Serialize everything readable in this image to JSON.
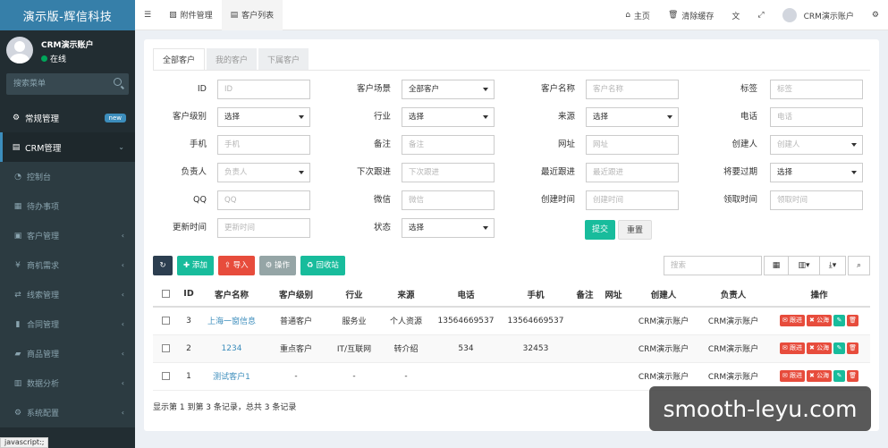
{
  "app": {
    "title": "演示版-辉信科技"
  },
  "user": {
    "name": "CRM演示账户",
    "status": "在线"
  },
  "sidebar": {
    "search_placeholder": "搜索菜单",
    "items": [
      {
        "label": "常规管理",
        "badge": "new"
      },
      {
        "label": "CRM管理"
      },
      {
        "label": "控制台"
      },
      {
        "label": "待办事项"
      },
      {
        "label": "客户管理"
      },
      {
        "label": "商机需求"
      },
      {
        "label": "线索管理"
      },
      {
        "label": "合同管理"
      },
      {
        "label": "商品管理"
      },
      {
        "label": "数据分析"
      },
      {
        "label": "系统配置"
      }
    ]
  },
  "topbar": {
    "nav": [
      "附件管理",
      "客户列表"
    ],
    "home": "主页",
    "clear_cache": "清除缓存",
    "account": "CRM演示账户"
  },
  "tabs": [
    "全部客户",
    "我的客户",
    "下属客户"
  ],
  "filters": {
    "rows": [
      [
        {
          "label": "ID",
          "type": "input",
          "placeholder": "ID"
        },
        {
          "label": "客户场景",
          "type": "select",
          "value": "全部客户"
        },
        {
          "label": "客户名称",
          "type": "input",
          "placeholder": "客户名称"
        },
        {
          "label": "标签",
          "type": "input",
          "placeholder": "标签"
        }
      ],
      [
        {
          "label": "客户级别",
          "type": "select",
          "value": "选择"
        },
        {
          "label": "行业",
          "type": "select",
          "value": "选择"
        },
        {
          "label": "来源",
          "type": "select",
          "value": "选择"
        },
        {
          "label": "电话",
          "type": "input",
          "placeholder": "电话"
        }
      ],
      [
        {
          "label": "手机",
          "type": "input",
          "placeholder": "手机"
        },
        {
          "label": "备注",
          "type": "input",
          "placeholder": "备注"
        },
        {
          "label": "网址",
          "type": "input",
          "placeholder": "网址"
        },
        {
          "label": "创建人",
          "type": "select",
          "value": "创建人",
          "ph": true
        }
      ],
      [
        {
          "label": "负责人",
          "type": "select",
          "value": "负责人",
          "ph": true
        },
        {
          "label": "下次跟进",
          "type": "input",
          "placeholder": "下次跟进"
        },
        {
          "label": "最近跟进",
          "type": "input",
          "placeholder": "最近跟进"
        },
        {
          "label": "将要过期",
          "type": "select",
          "value": "选择"
        }
      ],
      [
        {
          "label": "QQ",
          "type": "input",
          "placeholder": "QQ"
        },
        {
          "label": "微信",
          "type": "input",
          "placeholder": "微信"
        },
        {
          "label": "创建时间",
          "type": "input",
          "placeholder": "创建时间"
        },
        {
          "label": "领取时间",
          "type": "input",
          "placeholder": "领取时间"
        }
      ],
      [
        {
          "label": "更新时间",
          "type": "input",
          "placeholder": "更新时间"
        },
        {
          "label": "状态",
          "type": "select",
          "value": "选择"
        }
      ]
    ],
    "submit": "提交",
    "reset": "重置"
  },
  "toolbar": {
    "add": "添加",
    "import": "导入",
    "ops": "操作",
    "recycle": "回收站",
    "search_placeholder": "搜索"
  },
  "table": {
    "columns": [
      "ID",
      "客户名称",
      "客户级别",
      "行业",
      "来源",
      "电话",
      "手机",
      "备注",
      "网址",
      "创建人",
      "负责人",
      "操作"
    ],
    "rows": [
      {
        "id": "3",
        "name": "上海一窗信息",
        "level": "普通客户",
        "industry": "服务业",
        "source": "个人资源",
        "phone": "13564669537",
        "mobile": "13564669537",
        "remark": "",
        "url": "",
        "creator": "CRM演示账户",
        "owner": "CRM演示账户"
      },
      {
        "id": "2",
        "name": "1234",
        "level": "重点客户",
        "industry": "IT/互联网",
        "source": "转介绍",
        "phone": "534",
        "mobile": "32453",
        "remark": "",
        "url": "",
        "creator": "CRM演示账户",
        "owner": "CRM演示账户"
      },
      {
        "id": "1",
        "name": "测试客户1",
        "level": "-",
        "industry": "-",
        "source": "-",
        "phone": "",
        "mobile": "",
        "remark": "",
        "url": "",
        "creator": "CRM演示账户",
        "owner": "CRM演示账户"
      }
    ],
    "action_follow": "跟进",
    "action_public": "公海"
  },
  "pager": {
    "info": "显示第 1 到第 3 条记录，总共 3 条记录"
  },
  "watermark": "smooth-leyu.com",
  "status_bar": "javascript:;"
}
